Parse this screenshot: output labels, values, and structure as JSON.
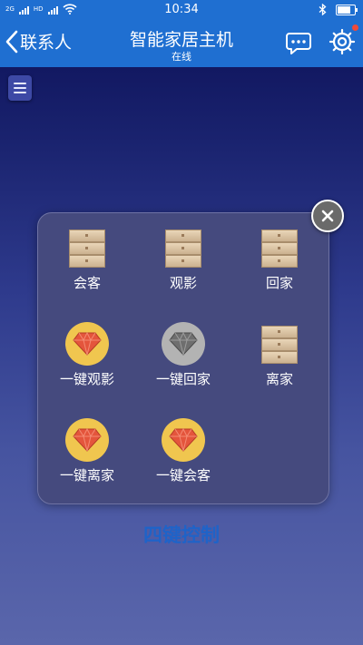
{
  "status_bar": {
    "network_1": "2G",
    "network_2": "HD",
    "time": "10:34",
    "battery_level": 0.85
  },
  "nav": {
    "back_label": "联系人",
    "title": "智能家居主机",
    "subtitle": "在线"
  },
  "panel": {
    "scenes": [
      {
        "label": "会客",
        "icon": "switch-panel-icon"
      },
      {
        "label": "观影",
        "icon": "switch-panel-icon"
      },
      {
        "label": "回家",
        "icon": "switch-panel-icon"
      },
      {
        "label": "一键观影",
        "icon": "ruby-gem-icon"
      },
      {
        "label": "一键回家",
        "icon": "gray-gem-icon"
      },
      {
        "label": "离家",
        "icon": "switch-panel-icon"
      },
      {
        "label": "一键离家",
        "icon": "ruby-gem-icon"
      },
      {
        "label": "一键会客",
        "icon": "ruby-gem-icon"
      }
    ]
  },
  "footer": {
    "title": "四键控制"
  },
  "colors": {
    "header": "#1f6fd1",
    "accent_text": "#1f63c8",
    "gem_gold": "#f0c64f",
    "gem_red": "#e4553c",
    "gem_gray": "#b3b3b3",
    "notification_dot": "#f04a3a"
  }
}
